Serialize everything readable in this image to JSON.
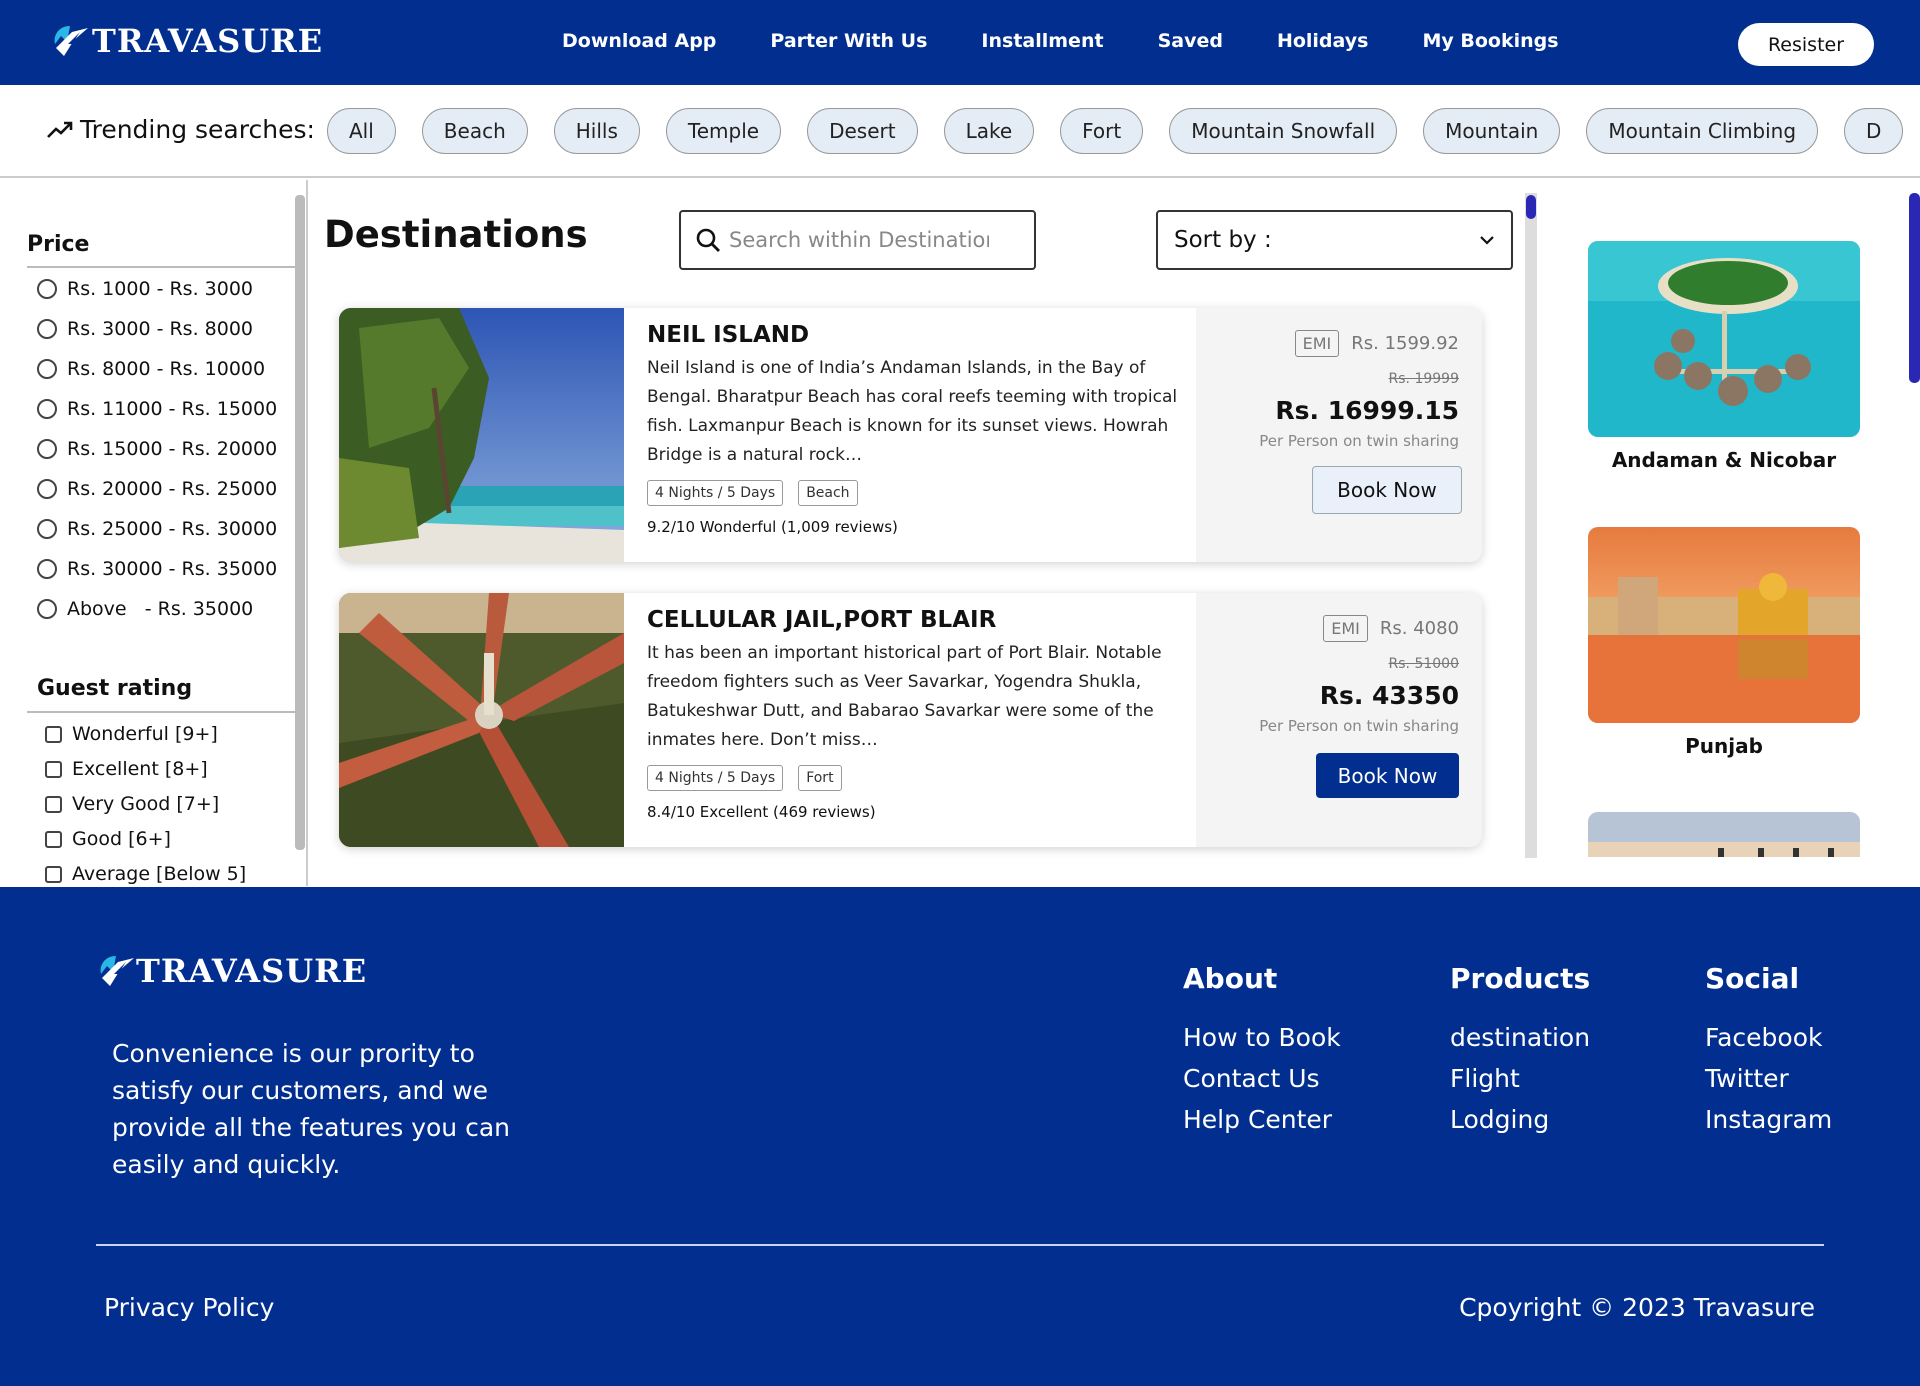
{
  "brand": {
    "name": "TRAVASURE"
  },
  "header": {
    "nav": [
      "Download App",
      "Parter With Us",
      "Installment",
      "Saved",
      "Holidays",
      "My Bookings"
    ],
    "register_label": "Resister"
  },
  "trending": {
    "label": "Trending searches:",
    "chips": [
      "All",
      "Beach",
      "Hills",
      "Temple",
      "Desert",
      "Lake",
      "Fort",
      "Mountain Snowfall",
      "Mountain",
      "Mountain Climbing",
      "D"
    ]
  },
  "filters": {
    "price": {
      "title": "Price",
      "options": [
        "Rs. 1000 - Rs. 3000",
        "Rs. 3000 - Rs. 8000",
        "Rs. 8000 - Rs. 10000",
        "Rs. 11000 - Rs. 15000",
        "Rs. 15000 - Rs. 20000",
        "Rs. 20000 - Rs. 25000",
        "Rs. 25000 - Rs. 30000",
        "Rs. 30000 - Rs. 35000",
        "Above   - Rs. 35000"
      ]
    },
    "guest_rating": {
      "title": "Guest rating",
      "options": [
        "Wonderful [9+]",
        "Excellent [8+]",
        "Very Good [7+]",
        "Good [6+]",
        "Average [Below 5]"
      ]
    }
  },
  "main": {
    "title": "Destinations",
    "search_placeholder": "Search within Destinations",
    "sort_label": "Sort by :"
  },
  "cards": [
    {
      "name": "NEIL ISLAND",
      "desc": "Neil Island is one of India’s Andaman Islands, in the Bay of Bengal. Bharatpur Beach has coral reefs teeming with tropical fish. Laxmanpur Beach is known for its sunset views. Howrah Bridge is a natural rock…",
      "duration": "4 Nights / 5 Days",
      "category": "Beach",
      "rating": "9.2/10 Wonderful (1,009 reviews)",
      "emi_label": "EMI",
      "emi_price": "Rs. 1599.92",
      "old_price": "Rs. 19999",
      "price": "Rs. 16999.15",
      "per": "Per Person on twin sharing",
      "book_label": "Book Now"
    },
    {
      "name": "CELLULAR JAIL,PORT BLAIR",
      "desc": "It has been an important historical part of Port Blair. Notable freedom fighters such as Veer Savarkar, Yogendra Shukla, Batukeshwar Dutt, and Babarao Savarkar were some of the inmates here. Don’t miss…",
      "duration": "4 Nights / 5 Days",
      "category": "Fort",
      "rating": "8.4/10 Excellent (469 reviews)",
      "emi_label": "EMI",
      "emi_price": "Rs. 4080",
      "old_price": "Rs. 51000",
      "price": "Rs. 43350",
      "per": "Per Person on twin sharing",
      "book_label": "Book Now"
    }
  ],
  "rail": [
    "Andaman & Nicobar",
    "Punjab"
  ],
  "footer": {
    "tagline": "Convenience is our prority to satisfy our customers, and we provide all the features you can easily and quickly.",
    "about": {
      "title": "About",
      "links": [
        "How to Book",
        "Contact Us",
        "Help Center"
      ]
    },
    "products": {
      "title": "Products",
      "links": [
        "destination",
        "Flight",
        "Lodging"
      ]
    },
    "social": {
      "title": "Social",
      "links": [
        "Facebook",
        "Twitter",
        "Instagram"
      ]
    },
    "privacy": "Privacy Policy",
    "copyright": "Cpoyright © 2023 Travasure"
  },
  "colors": {
    "brand_blue": "#022f8f",
    "chip_bg": "#e4ecf6",
    "scroll_accent": "#2a27b5"
  },
  "icons": [
    "logo-icon",
    "trending-icon",
    "search-icon",
    "chevron-down-icon"
  ]
}
